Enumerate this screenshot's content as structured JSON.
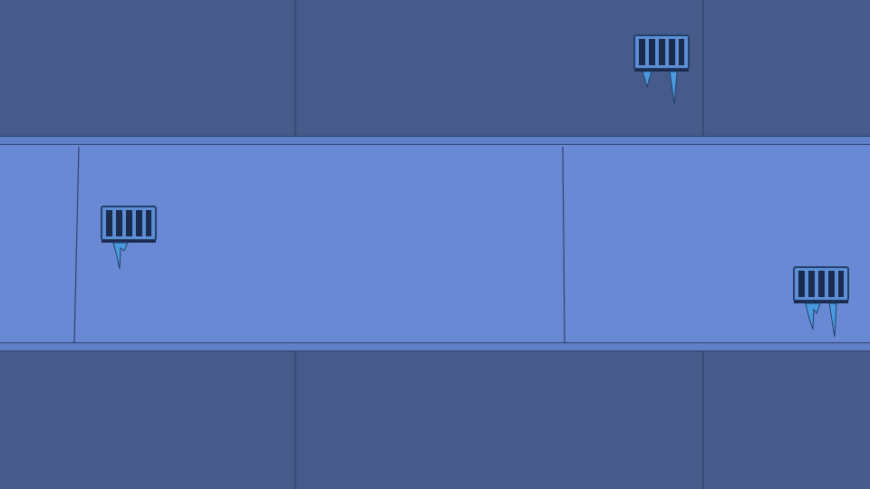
{
  "scene": {
    "colors": {
      "wall_dark": "#465b8a",
      "corridor": "#6a89d4",
      "ledge": "#5f7fc9",
      "outline": "#2f4370",
      "grate_frame": "#5c8ed6",
      "grate_bars": "#1b2b4d",
      "icicle": "#4a9ae0",
      "icicle_outline": "#23406b"
    },
    "grates": [
      {
        "name": "top-right-grate",
        "icon": "ice-grate-icon",
        "icicles": 2
      },
      {
        "name": "left-corridor-grate",
        "icon": "ice-grate-icon",
        "icicles": 1
      },
      {
        "name": "right-corridor-grate",
        "icon": "ice-grate-icon",
        "icicles": 2
      }
    ]
  }
}
